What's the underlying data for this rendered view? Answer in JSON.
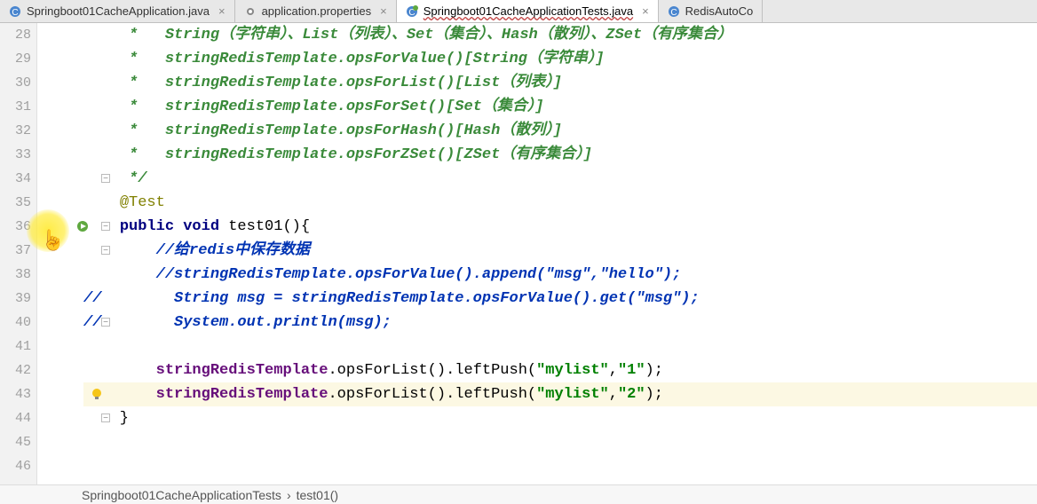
{
  "tabs": [
    {
      "name": "Springboot01CacheApplication.java",
      "active": false,
      "icon": "class"
    },
    {
      "name": "application.properties",
      "active": false,
      "icon": "props"
    },
    {
      "name": "Springboot01CacheApplicationTests.java",
      "active": true,
      "icon": "class",
      "marked": true
    },
    {
      "name": "RedisAutoCo",
      "active": false,
      "icon": "class",
      "noclose": true
    }
  ],
  "lines": {
    "start": 28,
    "rows": [
      {
        "n": 28,
        "segs": [
          {
            "cls": "c-comment-green",
            "t": "     *   String（字符串）、List（列表）、Set（集合）、Hash（散列）、ZSet（有序集合）"
          }
        ]
      },
      {
        "n": 29,
        "segs": [
          {
            "cls": "c-comment-green",
            "t": "     *   stringRedisTemplate.opsForValue()[String（字符串）]"
          }
        ]
      },
      {
        "n": 30,
        "segs": [
          {
            "cls": "c-comment-green",
            "t": "     *   stringRedisTemplate.opsForList()[List（列表）]"
          }
        ]
      },
      {
        "n": 31,
        "segs": [
          {
            "cls": "c-comment-green",
            "t": "     *   stringRedisTemplate.opsForSet()[Set（集合）]"
          }
        ]
      },
      {
        "n": 32,
        "segs": [
          {
            "cls": "c-comment-green",
            "t": "     *   stringRedisTemplate.opsForHash()[Hash（散列）]"
          }
        ]
      },
      {
        "n": 33,
        "segs": [
          {
            "cls": "c-comment-green",
            "t": "     *   stringRedisTemplate.opsForZSet()[ZSet（有序集合）]"
          }
        ]
      },
      {
        "n": 34,
        "segs": [
          {
            "cls": "c-comment-green",
            "t": "     */"
          }
        ],
        "fold": "end"
      },
      {
        "n": 35,
        "segs": [
          {
            "cls": "",
            "t": "    "
          },
          {
            "cls": "c-ann",
            "t": "@Test"
          }
        ]
      },
      {
        "n": 36,
        "segs": [
          {
            "cls": "",
            "t": "    "
          },
          {
            "cls": "c-kw",
            "t": "public void"
          },
          {
            "cls": "",
            "t": " test01(){"
          }
        ],
        "run": true,
        "fold": "start"
      },
      {
        "n": 37,
        "segs": [
          {
            "cls": "",
            "t": "        "
          },
          {
            "cls": "c-blue-comment",
            "t": "//给redis中保存数据"
          }
        ],
        "fold": "start"
      },
      {
        "n": 38,
        "segs": [
          {
            "cls": "",
            "t": "        "
          },
          {
            "cls": "c-blue-comment",
            "t": "//stringRedisTemplate.opsForValue().append(\"msg\",\"hello\");"
          }
        ]
      },
      {
        "n": 39,
        "segs": [
          {
            "cls": "c-blue-comment",
            "t": "//        String msg = stringRedisTemplate.opsForValue().get(\"msg\");"
          }
        ]
      },
      {
        "n": 40,
        "segs": [
          {
            "cls": "c-blue-comment",
            "t": "//        System.out.println(msg);"
          }
        ],
        "fold": "end"
      },
      {
        "n": 41,
        "segs": [
          {
            "cls": "",
            "t": ""
          }
        ]
      },
      {
        "n": 42,
        "segs": [
          {
            "cls": "",
            "t": "        "
          },
          {
            "cls": "c-field",
            "t": "stringRedisTemplate"
          },
          {
            "cls": "",
            "t": ".opsForList().leftPush("
          },
          {
            "cls": "c-str",
            "t": "\"mylist\""
          },
          {
            "cls": "",
            "t": ","
          },
          {
            "cls": "c-str",
            "t": "\"1\""
          },
          {
            "cls": "",
            "t": ");"
          }
        ]
      },
      {
        "n": 43,
        "segs": [
          {
            "cls": "",
            "t": "        "
          },
          {
            "cls": "c-field",
            "t": "stringRedisTemplate"
          },
          {
            "cls": "",
            "t": ".opsForList().leftPush("
          },
          {
            "cls": "c-str",
            "t": "\"mylist\""
          },
          {
            "cls": "",
            "t": ","
          },
          {
            "cls": "c-str",
            "t": "\"2\""
          },
          {
            "cls": "",
            "t": ");"
          }
        ],
        "highlight": true,
        "bulb": true
      },
      {
        "n": 44,
        "segs": [
          {
            "cls": "",
            "t": "    }"
          }
        ],
        "fold": "end"
      },
      {
        "n": 45,
        "segs": [
          {
            "cls": "",
            "t": ""
          }
        ]
      },
      {
        "n": 46,
        "segs": [
          {
            "cls": "",
            "t": ""
          }
        ]
      }
    ]
  },
  "breadcrumb": {
    "class": "Springboot01CacheApplicationTests",
    "method": "test01()"
  },
  "icons": {
    "close": "×",
    "chevron": "›"
  }
}
